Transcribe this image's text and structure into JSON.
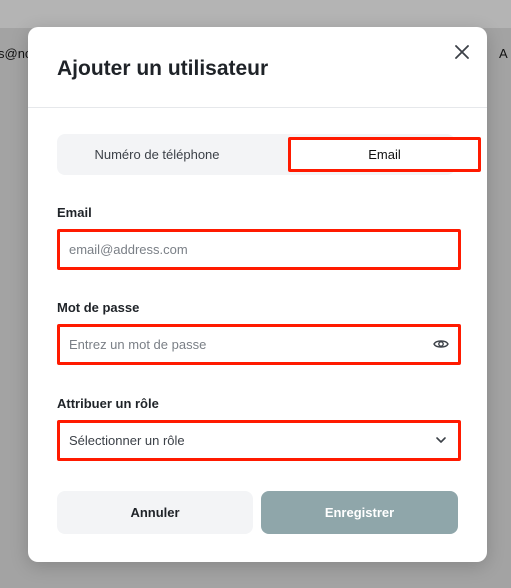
{
  "background": {
    "left_fragment": "s@nc",
    "right_fragment": "A"
  },
  "modal": {
    "title": "Ajouter un utilisateur",
    "tabs": [
      {
        "label": "Numéro de téléphone",
        "selected": false
      },
      {
        "label": "Email",
        "selected": true
      }
    ],
    "email": {
      "label": "Email",
      "placeholder": "email@address.com",
      "value": ""
    },
    "password": {
      "label": "Mot de passe",
      "placeholder": "Entrez un mot de passe",
      "value": ""
    },
    "role": {
      "label": "Attribuer un rôle",
      "selected_text": "Sélectionner un rôle"
    },
    "buttons": {
      "cancel": "Annuler",
      "save": "Enregistrer"
    }
  },
  "colors": {
    "highlight": "#ff1a00",
    "save_button": "#8fa6aa",
    "tab_track": "#f3f4f6"
  },
  "icons": {
    "close": "close-icon",
    "password_toggle": "eye-icon",
    "role_dropdown": "chevron-down-icon"
  }
}
